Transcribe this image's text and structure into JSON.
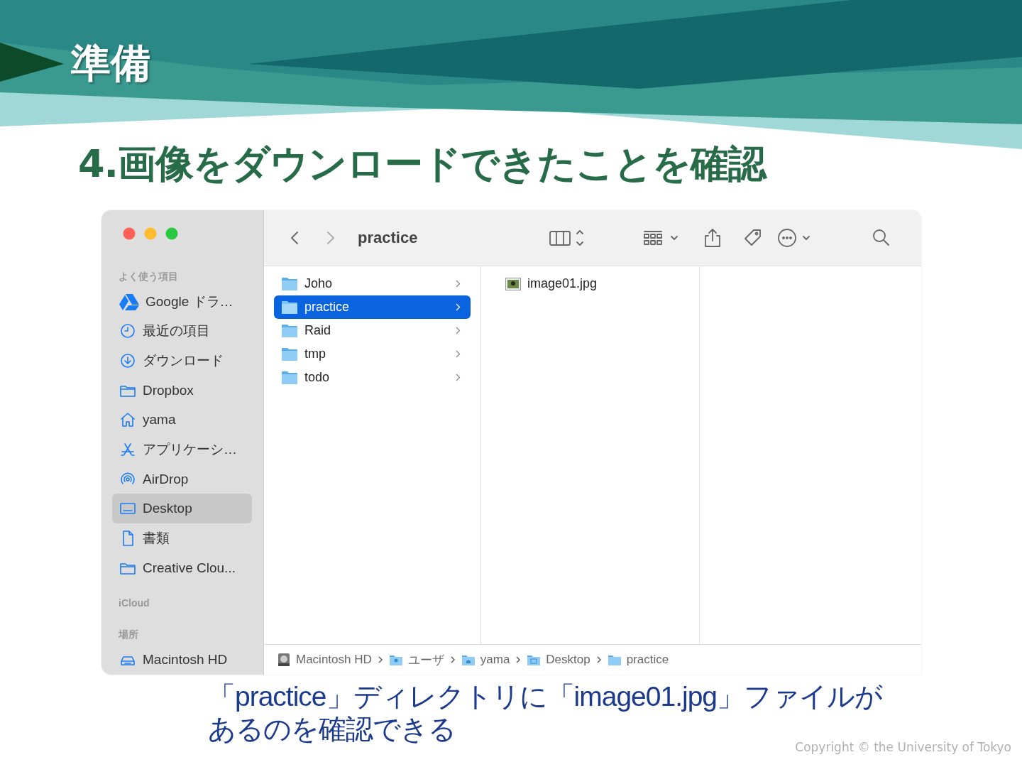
{
  "slide": {
    "section": "準備",
    "heading": "4.画像をダウンロードできたことを確認",
    "caption_lines": [
      "「practice」ディレクトリに「image01.jpg」ファイルが",
      "あるのを確認できる"
    ],
    "copyright": "Copyright © the University of Tokyo"
  },
  "finder": {
    "title": "practice",
    "sidebar": [
      {
        "heading": "よく使う項目",
        "items": [
          {
            "label": "Google ドラ…",
            "kind": "drive",
            "selected": false
          },
          {
            "label": "最近の項目",
            "kind": "clock",
            "selected": false
          },
          {
            "label": "ダウンロード",
            "kind": "download",
            "selected": false
          },
          {
            "label": "Dropbox",
            "kind": "folder",
            "selected": false
          },
          {
            "label": "yama",
            "kind": "home",
            "selected": false
          },
          {
            "label": "アプリケーシ…",
            "kind": "apps",
            "selected": false
          },
          {
            "label": "AirDrop",
            "kind": "airdrop",
            "selected": false
          },
          {
            "label": "Desktop",
            "kind": "desktop",
            "selected": true
          },
          {
            "label": "書類",
            "kind": "document",
            "selected": false
          },
          {
            "label": "Creative Clou...",
            "kind": "folder",
            "selected": false
          }
        ]
      },
      {
        "heading": "iCloud"
      },
      {
        "heading": "場所",
        "items": [
          {
            "label": "Macintosh HD",
            "kind": "disk",
            "selected": false
          }
        ]
      }
    ],
    "columns": [
      {
        "items": [
          {
            "label": "Joho",
            "kind": "folder",
            "selected": false
          },
          {
            "label": "practice",
            "kind": "folder",
            "selected": true
          },
          {
            "label": "Raid",
            "kind": "folder",
            "selected": false
          },
          {
            "label": "tmp",
            "kind": "folder",
            "selected": false
          },
          {
            "label": "todo",
            "kind": "folder",
            "selected": false
          }
        ]
      },
      {
        "items": [
          {
            "label": "image01.jpg",
            "kind": "image",
            "selected": false
          }
        ]
      }
    ],
    "path_bar": [
      {
        "label": "Macintosh HD",
        "kind": "disk"
      },
      {
        "label": "ユーザ",
        "kind": "users"
      },
      {
        "label": "yama",
        "kind": "home"
      },
      {
        "label": "Desktop",
        "kind": "desktop"
      },
      {
        "label": "practice",
        "kind": "folder"
      }
    ]
  }
}
